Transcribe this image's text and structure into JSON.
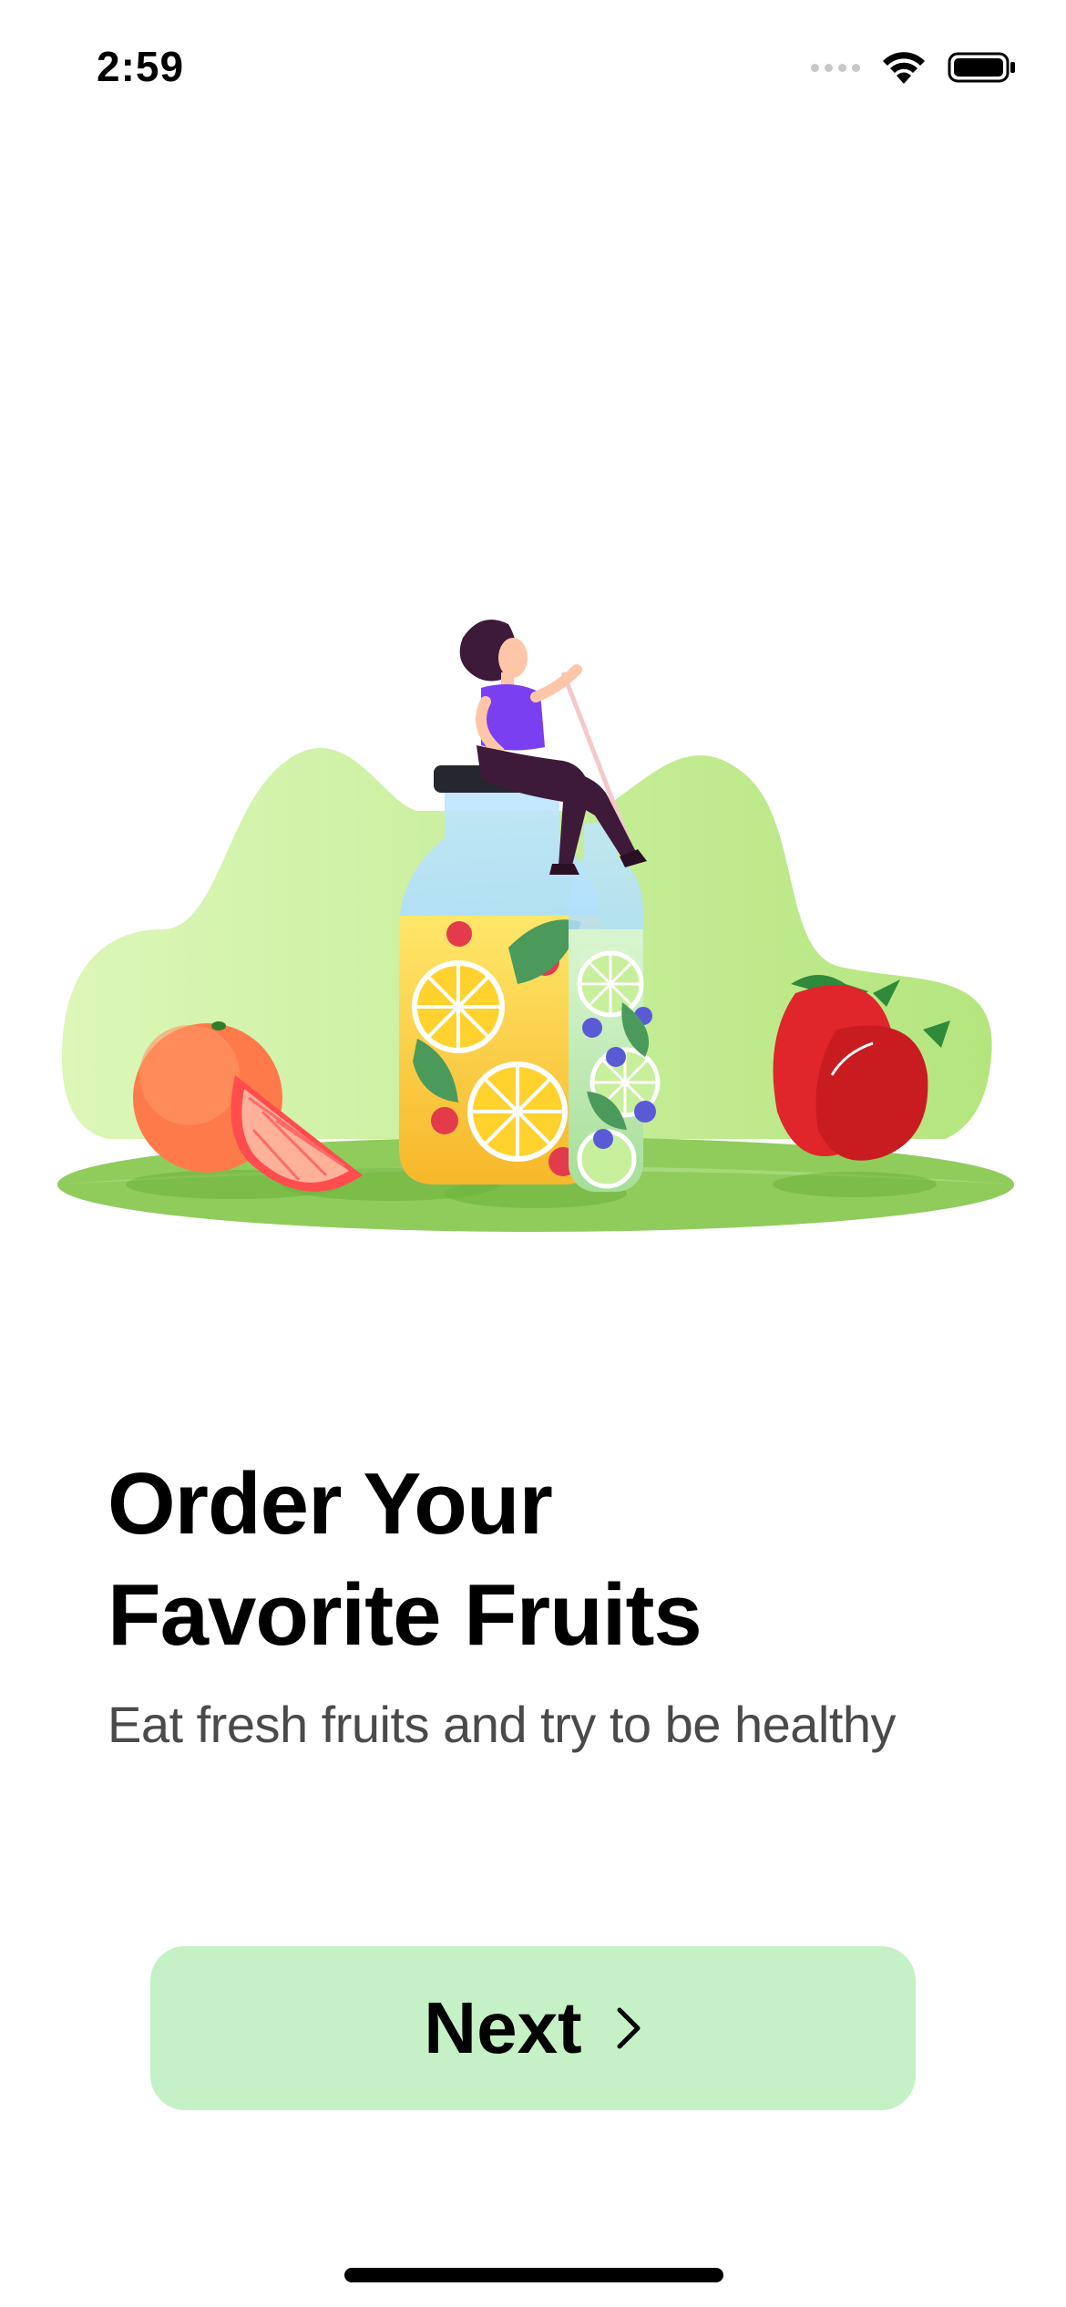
{
  "status_bar": {
    "time": "2:59",
    "icons": [
      "cellular-signal-icon",
      "wifi-icon",
      "battery-icon"
    ]
  },
  "hero": {
    "illustration": "woman-sitting-on-fruit-infused-water-bottles"
  },
  "onboarding": {
    "title_line1": "Order Your",
    "title_line2": "Favorite Fruits",
    "subtitle": "Eat fresh fruits and try to be healthy"
  },
  "actions": {
    "next_label": "Next",
    "next_icon": "chevron-right-icon"
  },
  "colors": {
    "button_bg": "#c6f1c6",
    "text_primary": "#000000",
    "text_secondary": "#4a4a4a",
    "hill_green": "#c5ee9b",
    "ground_green": "#8fcc5c"
  }
}
